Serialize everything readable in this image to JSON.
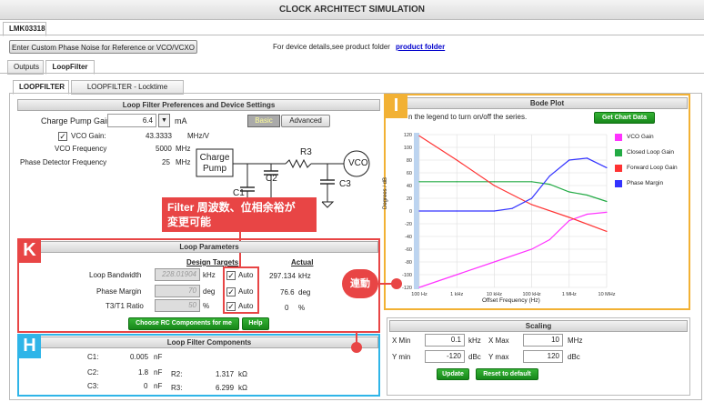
{
  "app": {
    "title": "CLOCK ARCHITECT SIMULATION",
    "device_tab": "LMK03318"
  },
  "top": {
    "phase_noise_button": "Enter Custom Phase Noise for Reference or VCO/VCXO",
    "device_text": "For device details,see product folder",
    "product_link": "product folder"
  },
  "tabs": [
    "Outputs",
    "LoopFilter"
  ],
  "subtabs": [
    "LOOPFILTER",
    "LOOPFILTER - Locktime"
  ],
  "prefs": {
    "header": "Loop Filter Preferences and Device Settings",
    "charge_pump_label": "Charge Pump Gain:",
    "charge_pump_value": "6.4",
    "charge_pump_unit": "mA",
    "basic": "Basic",
    "advanced": "Advanced",
    "vco_gain_label": "VCO Gain:",
    "vco_gain_value": "43.3333",
    "vco_gain_unit": "MHz/V",
    "vco_freq_label": "VCO Frequency",
    "vco_freq_value": "5000",
    "vco_freq_unit": "MHz",
    "pd_freq_label": "Phase Detector Frequency",
    "pd_freq_value": "25",
    "pd_freq_unit": "MHz"
  },
  "schematic": {
    "charge_pump_line1": "Charge",
    "charge_pump_line2": "Pump",
    "vco": "VCO",
    "r3": "R3",
    "c1": "C1",
    "c2": "C2",
    "c3": "C3"
  },
  "callout_filter": {
    "line1": "Filter 周波数、位相余裕が",
    "line2": "変更可能"
  },
  "loop_params": {
    "header": "Loop Parameters",
    "design_targets": "Design Targets",
    "actual": "Actual",
    "rows": [
      {
        "label": "Loop Bandwidth",
        "target": "228.01904",
        "unit": "kHz",
        "auto": "Auto",
        "actual": "297.134",
        "actual_unit": "kHz"
      },
      {
        "label": "Phase Margin",
        "target": "70",
        "unit": "deg",
        "auto": "Auto",
        "actual": "76.6",
        "actual_unit": "deg"
      },
      {
        "label": "T3/T1 Ratio",
        "target": "50",
        "unit": "%",
        "auto": "Auto",
        "actual": "0",
        "actual_unit": "%"
      }
    ],
    "choose_button": "Choose RC Components for me",
    "help_button": "Help"
  },
  "components": {
    "header": "Loop Filter Components",
    "c1_label": "C1:",
    "c1_value": "0.005",
    "c1_unit": "nF",
    "c2_label": "C2:",
    "c2_value": "1.8",
    "c2_unit": "nF",
    "c3_label": "C3:",
    "c3_value": "0",
    "c3_unit": "nF",
    "r2_label": "R2:",
    "r2_value": "1.317",
    "r2_unit": "kΩ",
    "r3_label": "R3:",
    "r3_value": "6.299",
    "r3_unit": "kΩ"
  },
  "bode": {
    "header": "Bode Plot",
    "hint": "n the legend to turn on/off the series.",
    "get_chart_button": "Get Chart Data"
  },
  "chart_data": {
    "type": "line",
    "xlabel": "Offset Frequency (Hz)",
    "ylabel": "Degrees / dB",
    "x_ticks": [
      "100 Hz",
      "1 kHz",
      "10 kHz",
      "100 kHz",
      "1 MHz",
      "10 MHz"
    ],
    "x_log_range": [
      100,
      10000000
    ],
    "y_ticks": [
      120,
      100,
      80,
      60,
      40,
      20,
      0,
      -20,
      -40,
      -60,
      -80,
      -100,
      -120
    ],
    "ylim": [
      -120,
      120
    ],
    "grid": true,
    "legend_position": "right",
    "series": [
      {
        "name": "VCO Gain",
        "color": "#ff33ff",
        "x": [
          100,
          1000,
          10000,
          100000,
          300000,
          1000000,
          3000000,
          10000000
        ],
        "y": [
          -120,
          -100,
          -80,
          -60,
          -45,
          -15,
          -5,
          -2
        ]
      },
      {
        "name": "Closed Loop Gain",
        "color": "#22aa44",
        "x": [
          100,
          1000,
          10000,
          100000,
          300000,
          1000000,
          3000000,
          10000000
        ],
        "y": [
          46,
          46,
          46,
          46,
          42,
          30,
          25,
          15
        ]
      },
      {
        "name": "Forward Loop Gain",
        "color": "#ff3333",
        "x": [
          100,
          1000,
          10000,
          100000,
          1000000,
          10000000
        ],
        "y": [
          118,
          80,
          40,
          10,
          -10,
          -32
        ]
      },
      {
        "name": "Phase Margin",
        "color": "#3333ff",
        "x": [
          100,
          1000,
          10000,
          30000,
          100000,
          300000,
          1000000,
          3000000,
          10000000
        ],
        "y": [
          0,
          0,
          0,
          4,
          20,
          55,
          80,
          83,
          68
        ]
      }
    ]
  },
  "scaling": {
    "header": "Scaling",
    "xmin_label": "X Min",
    "xmin_value": "0.1",
    "xmin_unit": "kHz",
    "xmax_label": "X Max",
    "xmax_value": "10",
    "xmax_unit": "MHz",
    "ymin_label": "Y min",
    "ymin_value": "-120",
    "ymin_unit": "dBc",
    "ymax_label": "Y max",
    "ymax_value": "120",
    "ymax_unit": "dBc",
    "update_button": "Update",
    "reset_button": "Reset to default"
  },
  "annotations": {
    "tag_i": "I",
    "tag_k": "K",
    "tag_h": "H",
    "link_label": "連動"
  }
}
